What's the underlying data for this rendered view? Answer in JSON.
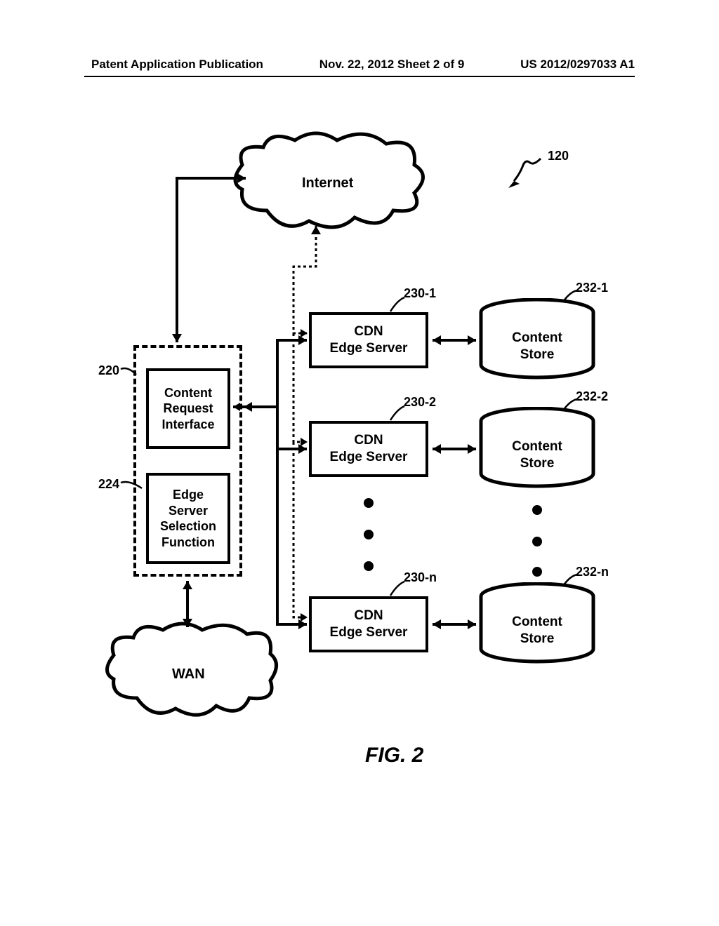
{
  "header": {
    "left": "Patent Application Publication",
    "center": "Nov. 22, 2012  Sheet 2 of 9",
    "right": "US 2012/0297033 A1"
  },
  "clouds": {
    "internet": "Internet",
    "wan": "WAN"
  },
  "interface_group": {
    "cri": "Content\nRequest\nInterface",
    "essf": "Edge\nServer\nSelection\nFunction"
  },
  "edge_servers": {
    "label": "CDN\nEdge Server"
  },
  "content_stores": {
    "label": "Content\nStore"
  },
  "refs": {
    "main": "120",
    "cri": "220",
    "essf": "224",
    "es1": "230-1",
    "es2": "230-2",
    "esn": "230-n",
    "cs1": "232-1",
    "cs2": "232-2",
    "csn": "232-n"
  },
  "figure": "FIG. 2"
}
